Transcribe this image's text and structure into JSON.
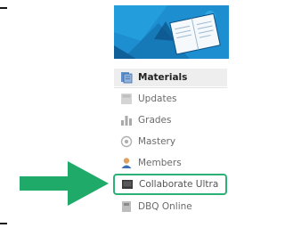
{
  "menu": {
    "items": [
      {
        "label": "Materials",
        "icon": "materials-icon"
      },
      {
        "label": "Updates",
        "icon": "updates-icon"
      },
      {
        "label": "Grades",
        "icon": "grades-icon"
      },
      {
        "label": "Mastery",
        "icon": "mastery-icon"
      },
      {
        "label": "Members",
        "icon": "members-icon"
      },
      {
        "label": "Collaborate Ultra",
        "icon": "collaborate-icon"
      },
      {
        "label": "DBQ Online",
        "icon": "dbq-icon"
      }
    ],
    "active_item": "Materials",
    "highlighted_item": "Collaborate Ultra"
  },
  "colors": {
    "banner": "#1d8fd0",
    "highlight": "#2bb075",
    "arrow": "#1faa6a"
  }
}
